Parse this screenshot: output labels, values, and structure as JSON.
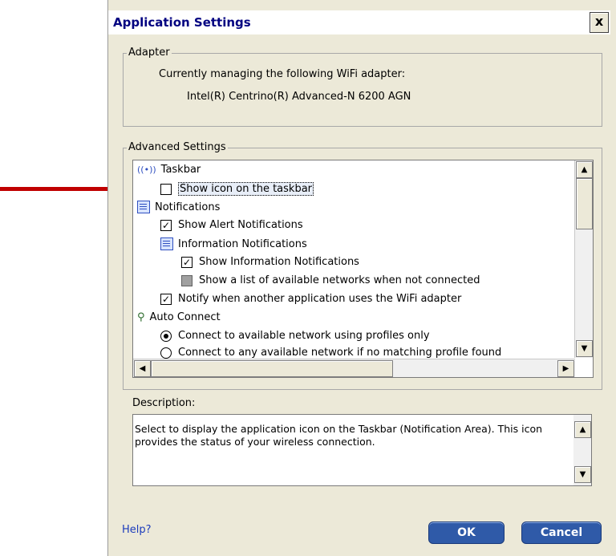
{
  "dialog": {
    "title": "Application Settings",
    "close_glyph": "x"
  },
  "adapter": {
    "legend": "Adapter",
    "intro": "Currently managing the following WiFi adapter:",
    "name": "Intel(R) Centrino(R) Advanced-N 6200 AGN"
  },
  "advanced": {
    "legend": "Advanced Settings",
    "items": [
      {
        "label": "Taskbar",
        "kind": "group",
        "icon": "wireless-signal-icon"
      },
      {
        "label": "Show icon on the taskbar",
        "kind": "checkbox",
        "checked": false,
        "selected": true
      },
      {
        "label": "Notifications",
        "kind": "group",
        "icon": "list-group-icon"
      },
      {
        "label": "Show Alert Notifications",
        "kind": "checkbox",
        "checked": true
      },
      {
        "label": "Information Notifications",
        "kind": "group",
        "icon": "list-group-icon"
      },
      {
        "label": "Show Information Notifications",
        "kind": "checkbox",
        "checked": true
      },
      {
        "label": "Show a list of available networks when not connected",
        "kind": "checkbox",
        "checked": false,
        "disabled": true
      },
      {
        "label": "Notify when another application uses the WiFi adapter",
        "kind": "checkbox",
        "checked": true
      },
      {
        "label": "Auto Connect",
        "kind": "group",
        "icon": "network-plug-icon"
      },
      {
        "label": "Connect to available network using profiles only",
        "kind": "radio",
        "checked": true
      },
      {
        "label": "Connect to any available network if no matching profile found",
        "kind": "radio",
        "checked": false
      }
    ],
    "scroll_up": "▲",
    "scroll_down": "▼",
    "scroll_left": "◀",
    "scroll_right": "▶"
  },
  "description": {
    "label": "Description:",
    "text": "Select to display the application icon on the Taskbar (Notification Area). This icon provides the status of your wireless connection."
  },
  "footer": {
    "help": "Help?",
    "ok": "OK",
    "cancel": "Cancel"
  },
  "colors": {
    "accent": "#c00000",
    "title": "#000080",
    "button": "#2f5aa8"
  }
}
